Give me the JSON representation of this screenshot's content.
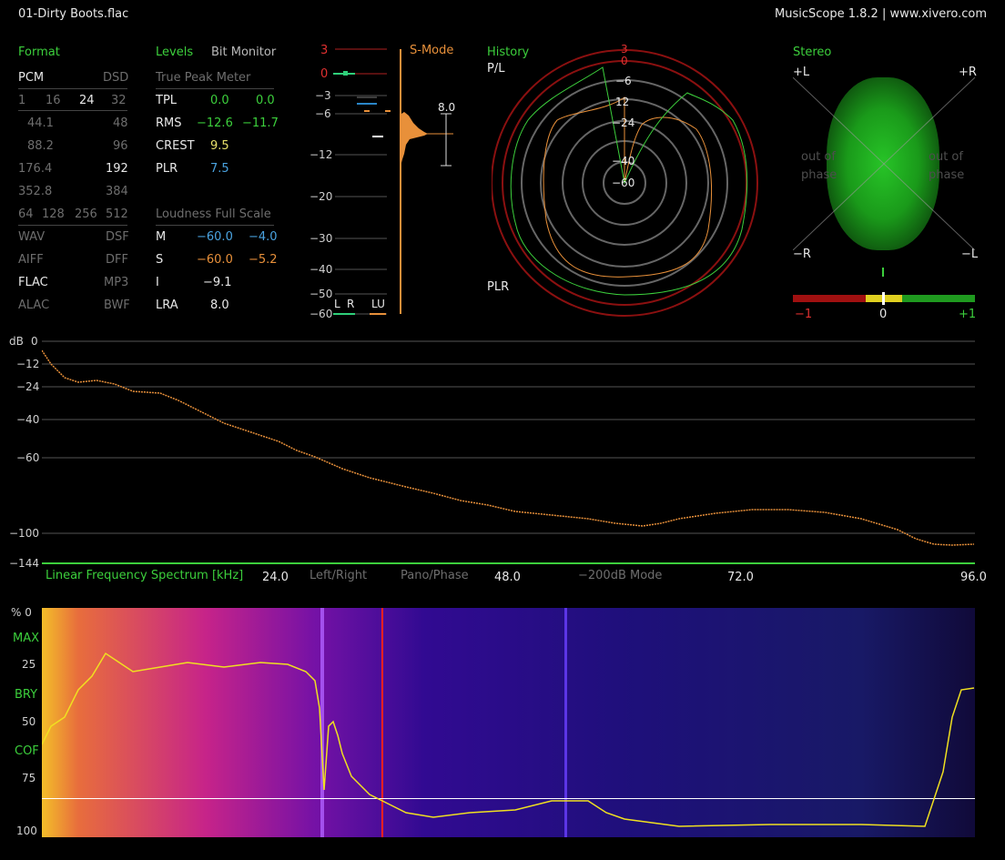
{
  "titlebar": {
    "file": "01-Dirty Boots.flac",
    "app": "MusicScope 1.8.2 | www.xivero.com"
  },
  "format": {
    "header": "Format",
    "pcm": "PCM",
    "dsd": "DSD",
    "bits": [
      "1",
      "16",
      "24",
      "32"
    ],
    "rates": [
      [
        "44.1",
        "48"
      ],
      [
        "88.2",
        "96"
      ],
      [
        "176.4",
        "192"
      ],
      [
        "352.8",
        "384"
      ]
    ],
    "dsd_rates": [
      "64",
      "128",
      "256",
      "512"
    ],
    "files": [
      [
        "WAV",
        "DSF"
      ],
      [
        "AIFF",
        "DFF"
      ],
      [
        "FLAC",
        "MP3"
      ],
      [
        "ALAC",
        "BWF"
      ]
    ]
  },
  "levels": {
    "header": "Levels",
    "bit_monitor": "Bit Monitor",
    "tpm_title": "True Peak Meter",
    "rows": [
      {
        "label": "TPL",
        "l": "0.0",
        "r": "0.0"
      },
      {
        "label": "RMS",
        "l": "−12.6",
        "r": "−11.7"
      },
      {
        "label": "CREST",
        "l": "9.5",
        "r": ""
      },
      {
        "label": "PLR",
        "l": "7.5",
        "r": ""
      }
    ],
    "lfs_title": "Loudness Full Scale",
    "loud": [
      {
        "label": "M",
        "l": "−60.0",
        "r": "−4.0"
      },
      {
        "label": "S",
        "l": "−60.0",
        "r": "−5.2"
      },
      {
        "label": "I",
        "l": "−9.1",
        "r": ""
      },
      {
        "label": "LRA",
        "l": "8.0",
        "r": ""
      }
    ]
  },
  "meter": {
    "mode": "S-Mode",
    "ticks": [
      "3",
      "0",
      "−3",
      "−6",
      "−12",
      "−20",
      "−30",
      "−40",
      "−50",
      "−60"
    ],
    "lra_value": "8.0",
    "legend": [
      "L",
      "R",
      "LU"
    ]
  },
  "history": {
    "header": "History",
    "pl": "P/L",
    "plr": "PLR",
    "rings": [
      "3",
      "0",
      "−6",
      "12",
      "−24",
      "−40",
      "−60"
    ]
  },
  "stereo": {
    "header": "Stereo",
    "tl": "+L",
    "tr": "+R",
    "bl": "−R",
    "br": "−L",
    "oop_left": "out of\nphase",
    "oop_right": "out of\nphase",
    "corr": [
      "−1",
      "0",
      "+1"
    ]
  },
  "spectrum": {
    "db_label": "dB",
    "yticks": [
      "0",
      "−12",
      "−24",
      "−40",
      "−60",
      "−100",
      "−144"
    ],
    "title": "Linear Frequency Spectrum [kHz]",
    "xticks": [
      "24.0",
      "48.0",
      "72.0",
      "96.0"
    ],
    "modes": [
      "Left/Right",
      "Pano/Phase",
      "−200dB Mode"
    ]
  },
  "spectrogram": {
    "yticks": [
      "%  0",
      "25",
      "50",
      "75",
      "100"
    ],
    "markers": [
      "MAX",
      "BRY",
      "COF"
    ]
  },
  "colors": {
    "green": "#3ccf3c",
    "orange": "#e8903a",
    "blue": "#4aa3e0",
    "red": "#c01818"
  }
}
